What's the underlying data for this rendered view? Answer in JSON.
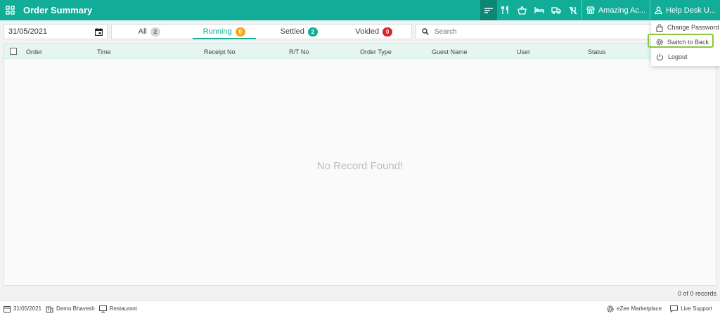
{
  "header": {
    "title": "Order Summary",
    "store": "Amazing Ac...",
    "user": "Help Desk U...",
    "icons": [
      "grid-icon",
      "order-list-icon",
      "dine-in-icon",
      "basket-icon",
      "bed-icon",
      "delivery-truck-icon",
      "no-dine-icon",
      "store-icon",
      "user-icon"
    ]
  },
  "toolbar": {
    "date": "31/05/2021",
    "tabs": [
      {
        "label": "All",
        "count": "2"
      },
      {
        "label": "Running",
        "count": "0"
      },
      {
        "label": "Settled",
        "count": "2"
      },
      {
        "label": "Voided",
        "count": "0"
      }
    ],
    "search_placeholder": "Search"
  },
  "table": {
    "columns": [
      "Order",
      "Time",
      "Receipt No",
      "R/T No",
      "Order Type",
      "Guest Name",
      "User",
      "Status"
    ],
    "empty_message": "No Record Found!",
    "record_count": "0 of 0 records"
  },
  "footer": {
    "date": "31/05/2021",
    "property": "Demo Bhavesh",
    "outlet": "Restaurant",
    "marketplace": "eZee Marketplace",
    "support": "Live Support"
  },
  "user_menu": {
    "items": [
      "Change Password",
      "Switch to Back",
      "Logout"
    ]
  },
  "colors": {
    "accent": "#11ad98",
    "running": "#f5a623",
    "voided": "#e0202d",
    "highlight": "#8cc63f"
  }
}
